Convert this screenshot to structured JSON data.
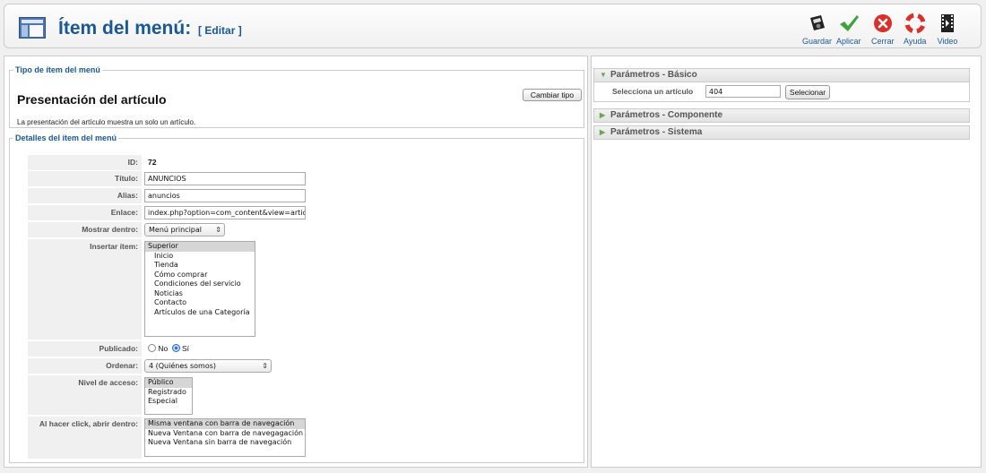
{
  "header": {
    "title": "Ítem del menú:",
    "subtitle": "[ Editar ]"
  },
  "toolbar": {
    "buttons": [
      {
        "label": "Guardar",
        "icon": "save-icon"
      },
      {
        "label": "Aplicar",
        "icon": "apply-check-icon"
      },
      {
        "label": "Cerrar",
        "icon": "close-icon"
      },
      {
        "label": "Ayuda",
        "icon": "help-lifebuoy-icon"
      },
      {
        "label": "Video",
        "icon": "video-icon"
      }
    ]
  },
  "menu_type": {
    "legend": "Tipo de ítem del menú",
    "title": "Presentación del artículo",
    "description": "La presentación del artículo muestra un solo un artículo.",
    "change_button": "Cambiar tipo"
  },
  "details": {
    "legend": "Detalles del ítem del menú",
    "id_label": "ID:",
    "id_value": "72",
    "title_label": "Título:",
    "title_value": "ANUNCIOS",
    "alias_label": "Alias:",
    "alias_value": "anuncios",
    "link_label": "Enlace:",
    "link_value": "index.php?option=com_content&view=articl",
    "show_in_label": "Mostrar dentro:",
    "show_in_value": "Menú principal",
    "insert_label": "Insertar ítem:",
    "insert_items": [
      "Superior",
      "Inicio",
      "Tienda",
      "Cómo comprar",
      "Condiciones del servicio",
      "Noticias",
      "Contacto",
      "Artículos de una Categoría"
    ],
    "published_label": "Publicado:",
    "published_no": "No",
    "published_yes": "Sí",
    "published_value": "Sí",
    "order_label": "Ordenar:",
    "order_value": "4 (Quiénes somos)",
    "access_label": "Nivel de acceso:",
    "access_items": [
      "Público",
      "Registrado",
      "Especial"
    ],
    "click_label": "Al hacer click, abrir dentro:",
    "click_items": [
      "Misma ventana con barra de navegación",
      "Nueva Ventana con barra de navegagación",
      "Nueva Ventana sin barra de navegación"
    ]
  },
  "params": {
    "basic_title": "Parámetros - Básico",
    "select_article_label": "Selecciona un artículo",
    "select_article_value": "404",
    "select_button": "Selecionar",
    "component_title": "Parámetros - Componente",
    "system_title": "Parámetros - Sistema"
  }
}
